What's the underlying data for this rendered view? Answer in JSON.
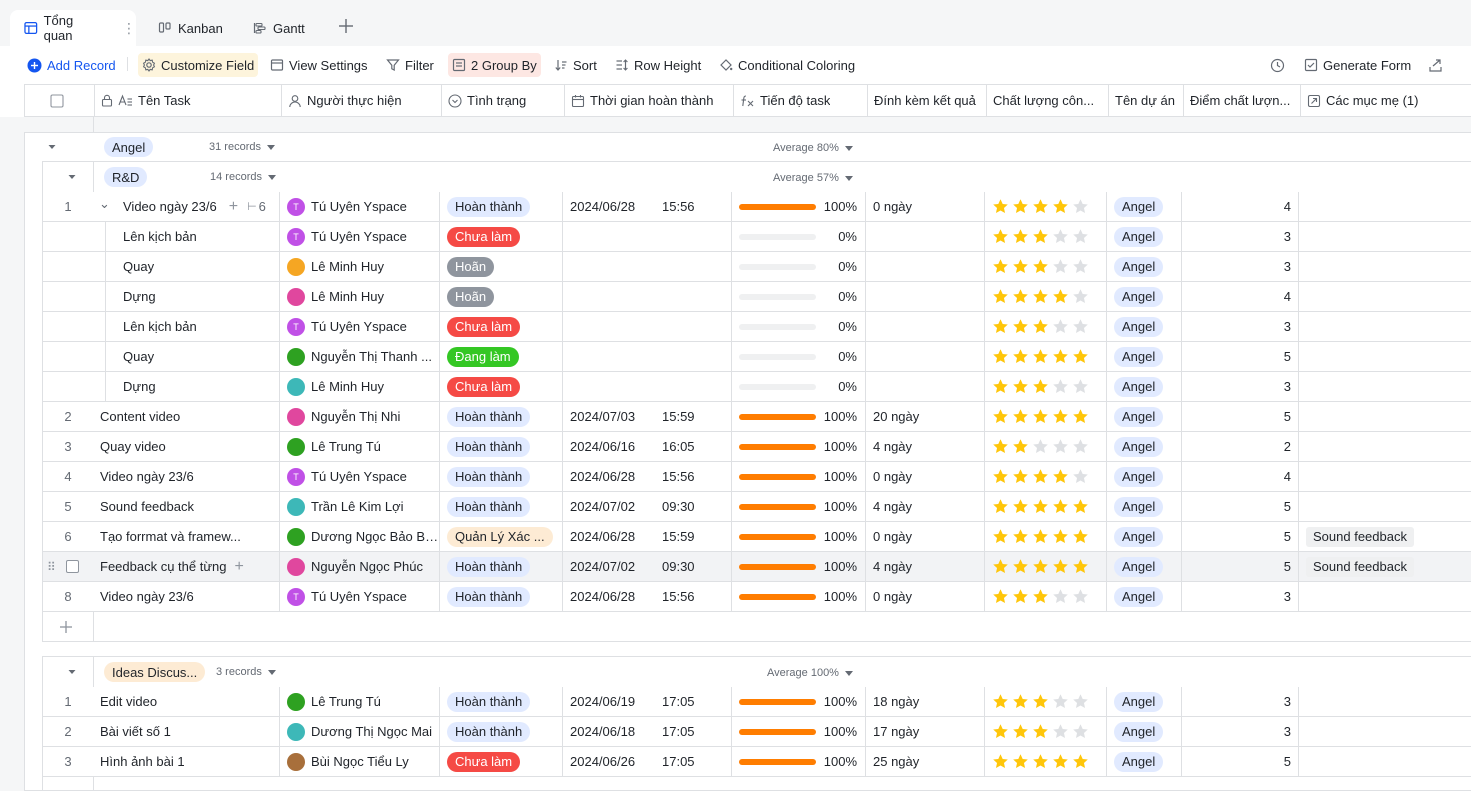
{
  "tabs": [
    {
      "label": "Tổng quan",
      "icon": "table-icon",
      "active": true
    },
    {
      "label": "Kanban",
      "icon": "kanban-icon"
    },
    {
      "label": "Gantt",
      "icon": "gantt-icon"
    }
  ],
  "toolbar": {
    "add_record": "Add Record",
    "customize_field": "Customize Field",
    "view_settings": "View Settings",
    "filter": "Filter",
    "group_by": "2 Group By",
    "sort": "Sort",
    "row_height": "Row Height",
    "conditional_coloring": "Conditional Coloring",
    "generate_form": "Generate Form"
  },
  "columns": [
    {
      "key": "task",
      "label": "Tên Task",
      "icon": "text-field-icon"
    },
    {
      "key": "assignee",
      "label": "Người thực hiện",
      "icon": "person-icon"
    },
    {
      "key": "status",
      "label": "Tình trạng",
      "icon": "single-select-icon"
    },
    {
      "key": "done_time",
      "label": "Thời gian hoàn thành",
      "icon": "calendar-icon"
    },
    {
      "key": "progress",
      "label": "Tiến độ task",
      "icon": "formula-icon"
    },
    {
      "key": "attachment",
      "label": "Đính kèm kết quả",
      "icon": ""
    },
    {
      "key": "quality",
      "label": "Chất lượng côn...",
      "icon": ""
    },
    {
      "key": "project",
      "label": "Tên dự án",
      "icon": ""
    },
    {
      "key": "score",
      "label": "Điểm chất lượn...",
      "icon": ""
    },
    {
      "key": "parent",
      "label": "Các mục mẹ (1)",
      "icon": "parent-link-icon"
    }
  ],
  "groups": {
    "angel": {
      "label": "Angel",
      "count": "31 records",
      "average": "Average 80%"
    },
    "rnd": {
      "label": "R&D",
      "count": "14 records",
      "average": "Average 57%"
    },
    "ideas": {
      "label": "Ideas Discus...",
      "count": "3 records",
      "average": "Average 100%"
    }
  },
  "subtask_count": "6",
  "rnd_rows": [
    {
      "idx": "1",
      "task": "Video ngày 23/6",
      "assignee": "Tú Uyên Yspace",
      "avatar": "T",
      "status": "Hoàn thành",
      "st": "done",
      "date": "2024/06/28",
      "time": "15:56",
      "progress": 100,
      "progress_label": "100%",
      "attach": "0 ngày",
      "stars": 4,
      "project": "Angel",
      "score": "4",
      "parent": ""
    },
    {
      "idx": "",
      "task": "Lên kịch bản",
      "assignee": "Tú Uyên Yspace",
      "avatar": "T",
      "status": "Chưa làm",
      "st": "todo",
      "date": "",
      "time": "",
      "progress": 0,
      "progress_label": "0%",
      "attach": "",
      "stars": 3,
      "project": "Angel",
      "score": "3",
      "parent": ""
    },
    {
      "idx": "",
      "task": "Quay",
      "assignee": "Lê Minh Huy",
      "avatar": "",
      "status": "Hoãn",
      "st": "hold",
      "date": "",
      "time": "",
      "progress": 0,
      "progress_label": "0%",
      "attach": "",
      "stars": 3,
      "project": "Angel",
      "score": "3",
      "parent": ""
    },
    {
      "idx": "",
      "task": "Dựng",
      "assignee": "Lê Minh Huy",
      "avatar": "",
      "status": "Hoãn",
      "st": "hold",
      "date": "",
      "time": "",
      "progress": 0,
      "progress_label": "0%",
      "attach": "",
      "stars": 4,
      "project": "Angel",
      "score": "4",
      "parent": ""
    },
    {
      "idx": "",
      "task": "Lên kịch bản",
      "assignee": "Tú Uyên Yspace",
      "avatar": "T",
      "status": "Chưa làm",
      "st": "todo",
      "date": "",
      "time": "",
      "progress": 0,
      "progress_label": "0%",
      "attach": "",
      "stars": 3,
      "project": "Angel",
      "score": "3",
      "parent": ""
    },
    {
      "idx": "",
      "task": "Quay",
      "assignee": "Nguyễn Thị Thanh ...",
      "avatar": "",
      "status": "Đang làm",
      "st": "doing",
      "date": "",
      "time": "",
      "progress": 0,
      "progress_label": "0%",
      "attach": "",
      "stars": 5,
      "project": "Angel",
      "score": "5",
      "parent": ""
    },
    {
      "idx": "",
      "task": "Dựng",
      "assignee": "Lê Minh Huy",
      "avatar": "",
      "status": "Chưa làm",
      "st": "todo",
      "date": "",
      "time": "",
      "progress": 0,
      "progress_label": "0%",
      "attach": "",
      "stars": 3,
      "project": "Angel",
      "score": "3",
      "parent": ""
    },
    {
      "idx": "2",
      "task": "Content video",
      "assignee": "Nguyễn Thị  Nhi",
      "avatar": "",
      "status": "Hoàn thành",
      "st": "done",
      "date": "2024/07/03",
      "time": "15:59",
      "progress": 100,
      "progress_label": "100%",
      "attach": "20 ngày",
      "stars": 5,
      "project": "Angel",
      "score": "5",
      "parent": ""
    },
    {
      "idx": "3",
      "task": "Quay video",
      "assignee": "Lê Trung Tú",
      "avatar": "",
      "status": "Hoàn thành",
      "st": "done",
      "date": "2024/06/16",
      "time": "16:05",
      "progress": 100,
      "progress_label": "100%",
      "attach": "4 ngày",
      "stars": 2,
      "project": "Angel",
      "score": "2",
      "parent": ""
    },
    {
      "idx": "4",
      "task": "Video ngày 23/6",
      "assignee": "Tú Uyên Yspace",
      "avatar": "T",
      "status": "Hoàn thành",
      "st": "done",
      "date": "2024/06/28",
      "time": "15:56",
      "progress": 100,
      "progress_label": "100%",
      "attach": "0 ngày",
      "stars": 4,
      "project": "Angel",
      "score": "4",
      "parent": ""
    },
    {
      "idx": "5",
      "task": "Sound feedback",
      "assignee": "Trần Lê Kim Lợi",
      "avatar": "",
      "status": "Hoàn thành",
      "st": "done",
      "date": "2024/07/02",
      "time": "09:30",
      "progress": 100,
      "progress_label": "100%",
      "attach": "4 ngày",
      "stars": 5,
      "project": "Angel",
      "score": "5",
      "parent": ""
    },
    {
      "idx": "6",
      "task": "Tạo forrmat và framew...",
      "assignee": "Dương Ngọc Bảo Bảo",
      "avatar": "",
      "status": "Quản Lý Xác ...",
      "st": "qly",
      "date": "2024/06/28",
      "time": "15:59",
      "progress": 100,
      "progress_label": "100%",
      "attach": "0 ngày",
      "stars": 5,
      "project": "Angel",
      "score": "5",
      "parent": "Sound feedback"
    },
    {
      "idx": "",
      "task": "Feedback cụ thể từng",
      "assignee": "Nguyễn Ngọc Phúc",
      "avatar": "",
      "status": "Hoàn thành",
      "st": "done",
      "date": "2024/07/02",
      "time": "09:30",
      "progress": 100,
      "progress_label": "100%",
      "attach": "4 ngày",
      "stars": 5,
      "project": "Angel",
      "score": "5",
      "parent": "Sound feedback"
    },
    {
      "idx": "8",
      "task": "Video ngày 23/6",
      "assignee": "Tú Uyên Yspace",
      "avatar": "T",
      "status": "Hoàn thành",
      "st": "done",
      "date": "2024/06/28",
      "time": "15:56",
      "progress": 100,
      "progress_label": "100%",
      "attach": "0 ngày",
      "stars": 3,
      "project": "Angel",
      "score": "3",
      "parent": ""
    }
  ],
  "ideas_rows": [
    {
      "idx": "1",
      "task": "Edit video",
      "assignee": "Lê Trung Tú",
      "avatar": "",
      "status": "Hoàn thành",
      "st": "done",
      "date": "2024/06/19",
      "time": "17:05",
      "progress": 100,
      "progress_label": "100%",
      "attach": "18 ngày",
      "stars": 3,
      "project": "Angel",
      "score": "3",
      "parent": ""
    },
    {
      "idx": "2",
      "task": "Bài viết số 1",
      "assignee": "Dương Thị Ngọc Mai",
      "avatar": "",
      "status": "Hoàn thành",
      "st": "done",
      "date": "2024/06/18",
      "time": "17:05",
      "progress": 100,
      "progress_label": "100%",
      "attach": "17 ngày",
      "stars": 3,
      "project": "Angel",
      "score": "3",
      "parent": ""
    },
    {
      "idx": "3",
      "task": "Hình ảnh bài 1",
      "assignee": "Bùi Ngọc Tiểu Ly",
      "avatar": "",
      "status": "Chưa làm",
      "st": "todo",
      "date": "2024/06/26",
      "time": "17:05",
      "progress": 100,
      "progress_label": "100%",
      "attach": "25 ngày",
      "stars": 5,
      "project": "Angel",
      "score": "5",
      "parent": ""
    }
  ],
  "colors": {
    "accent": "#1456f0",
    "progress": "#ff7d00",
    "star": "#ffc60a",
    "star_empty": "#dee0e3"
  }
}
